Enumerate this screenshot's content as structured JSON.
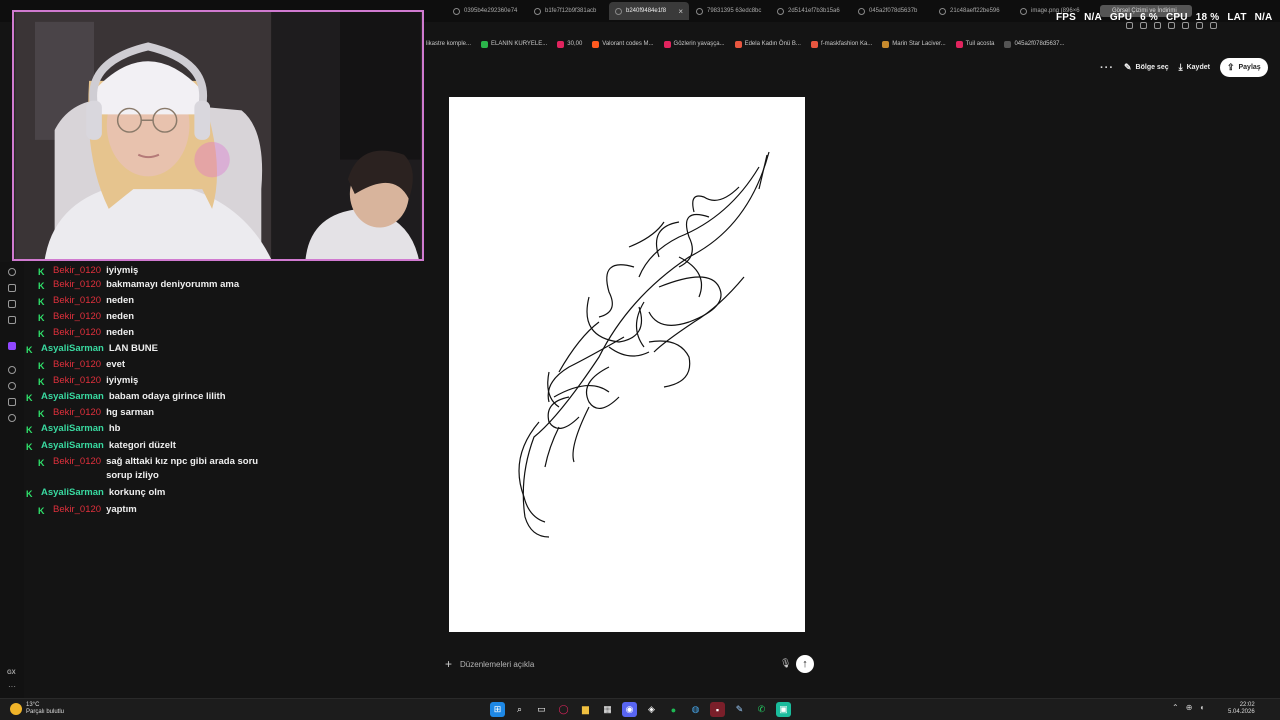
{
  "browser": {
    "tabs": [
      {
        "label": "0395b4e292360e74"
      },
      {
        "label": "b1fe7f12b9f381acb"
      },
      {
        "label": "b240f9484e1f8",
        "active": true
      },
      {
        "label": "79831395 63edc8bc"
      },
      {
        "label": "2d5141ef7b3b15a6"
      },
      {
        "label": "045a2f078d5637b"
      },
      {
        "label": "21c48aeff22be596"
      },
      {
        "label": "image.png (896×6"
      }
    ],
    "active_tab_close": "×",
    "download_chip": "Görsel Çizimi ve İndirimi"
  },
  "perf": {
    "fps_label": "FPS",
    "fps_value": "N/A",
    "gpu_label": "GPU",
    "gpu_value": "6 %",
    "cpu_label": "CPU",
    "cpu_value": "18 %",
    "lat_label": "LAT",
    "lat_value": "N/A"
  },
  "bookmarks": [
    {
      "label": "likastre komple...",
      "color": "#555"
    },
    {
      "label": "ELANIN KURYELE...",
      "color": "#2bb44a"
    },
    {
      "label": "30,00",
      "color": "#e0245e"
    },
    {
      "label": "Valorant codes M...",
      "color": "#ff5a1f"
    },
    {
      "label": "Gözlerin yavaşça...",
      "color": "#e0245e"
    },
    {
      "label": "Edela Kadın Önü B...",
      "color": "#e8563f"
    },
    {
      "label": "f-maskfashion Ka...",
      "color": "#e8563f"
    },
    {
      "label": "Marin Star Laciver...",
      "color": "#c78a2d"
    },
    {
      "label": "Tuil acosta",
      "color": "#e0245e"
    },
    {
      "label": "045a2f078d5637...",
      "color": "#555"
    }
  ],
  "chat": {
    "messages": [
      {
        "user": "Bekir_0120",
        "text": "iyiymiş",
        "color": "red"
      },
      {
        "user": "Bekir_0120",
        "text": "bakmamayı deniyorumm ama",
        "color": "red"
      },
      {
        "user": "Bekir_0120",
        "text": "neden",
        "color": "red"
      },
      {
        "user": "Bekir_0120",
        "text": "neden",
        "color": "red"
      },
      {
        "user": "Bekir_0120",
        "text": "neden",
        "color": "red"
      },
      {
        "user": "AsyaliSarman",
        "text": "LAN BUNE",
        "color": "green"
      },
      {
        "user": "Bekir_0120",
        "text": "evet",
        "color": "red"
      },
      {
        "user": "Bekir_0120",
        "text": "iyiymiş",
        "color": "red"
      },
      {
        "user": "AsyaliSarman",
        "text": "babam odaya girince lilith",
        "color": "green"
      },
      {
        "user": "Bekir_0120",
        "text": "hg sarman",
        "color": "red"
      },
      {
        "user": "AsyaliSarman",
        "text": "hb",
        "color": "green"
      },
      {
        "user": "AsyaliSarman",
        "text": "kategori düzelt",
        "color": "green"
      },
      {
        "user": "Bekir_0120",
        "text": "sağ alttaki kız npc gibi arada soru sorup izliyo",
        "color": "red"
      },
      {
        "user": "AsyaliSarman",
        "text": "korkunç olm",
        "color": "green"
      },
      {
        "user": "Bekir_0120",
        "text": "yaptım",
        "color": "red"
      }
    ],
    "badge": "K"
  },
  "rail": {
    "gx_label": "GX",
    "more": "···"
  },
  "toolbar": {
    "more": "···",
    "select_area": "Bölge seç",
    "save": "Kaydet",
    "share": "Paylaş"
  },
  "prompt": {
    "placeholder": "Düzenlemeleri açıkla",
    "plus": "+",
    "mic": "🎙",
    "send": "↑"
  },
  "taskbar": {
    "temperature": "13°C",
    "weather": "Parçalı bulutlu",
    "time": "22:02",
    "date": "5.04.2026"
  }
}
